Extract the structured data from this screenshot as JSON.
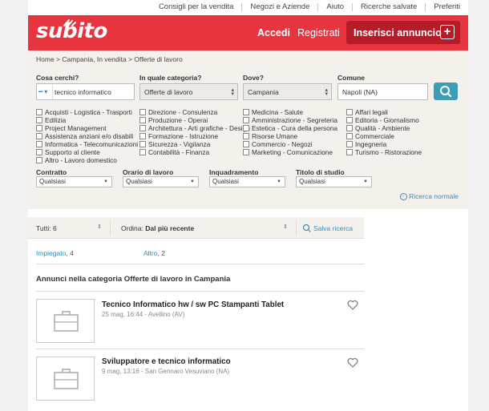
{
  "top_links": [
    "Consigli per la vendita",
    "Negozi e Aziende",
    "Aiuto",
    "Ricerche salvate",
    "Preferiti"
  ],
  "header": {
    "logo": "subito",
    "login": "Accedi",
    "register": "Registrati",
    "post_ad": "Inserisci annuncio",
    "brand_color": "#e7343f"
  },
  "breadcrumb": "Home  >  Campania, In vendita  >  Offerte di lavoro",
  "search": {
    "what_label": "Cosa cerchi?",
    "what_value": "tecnico informatico",
    "category_label": "In quale categoria?",
    "category_value": "Offerte di lavoro",
    "where_label": "Dove?",
    "where_value": "Campania",
    "comune_label": "Comune",
    "comune_value": "Napoli (NA)"
  },
  "categories": [
    [
      "Acquisti - Logistica - Trasporti",
      "Edilizia",
      "Project Management",
      "Assistenza anziani e/o disabili",
      "Informatica - Telecomunicazioni",
      "Supporto al cliente",
      "Altro - Lavoro domestico"
    ],
    [
      "Direzione - Consulenza",
      "Produzione - Operai",
      "Architettura - Arti grafiche - Design",
      "Formazione - Istruzione",
      "Sicurezza - Vigilanza",
      "Contabilità - Finanza"
    ],
    [
      "Medicina - Salute",
      "Amministrazione - Segreteria",
      "Estetica - Cura della persona",
      "Risorse Umane",
      "Commercio - Negozi",
      "Marketing - Comunicazione"
    ],
    [
      "Affari legali",
      "Editoria - Giornalismo",
      "Qualità - Ambiente",
      "Commerciale",
      "Ingegneria",
      "Turismo - Ristorazione"
    ]
  ],
  "filters": [
    {
      "label": "Contratto",
      "value": "Qualsiasi"
    },
    {
      "label": "Orario di lavoro",
      "value": "Qualsiasi"
    },
    {
      "label": "Inquadramento",
      "value": "Qualsiasi"
    },
    {
      "label": "Titolo di studio",
      "value": "Qualsiasi"
    }
  ],
  "advanced_toggle": "Ricerca normale",
  "results_bar": {
    "all": "Tutti: 6",
    "sort_label": "Ordina:",
    "sort_value": "Dal più recente",
    "save_search": "Salva ricerca"
  },
  "quick_filters": [
    {
      "label": "Impiegato",
      "count": ", 4"
    },
    {
      "label": "Altro",
      "count": ", 2"
    }
  ],
  "section_title": "Annunci nella categoria Offerte di lavoro in Campania",
  "listings": [
    {
      "title": "Tecnico Informatico hw / sw PC Stampanti Tablet",
      "meta": "25 mag, 16:44  -  Avellino (AV)"
    },
    {
      "title": "Sviluppatore e tecnico informatico",
      "meta": "9 mag, 13:16  -  San Gennaro Vesuviano (NA)"
    }
  ]
}
